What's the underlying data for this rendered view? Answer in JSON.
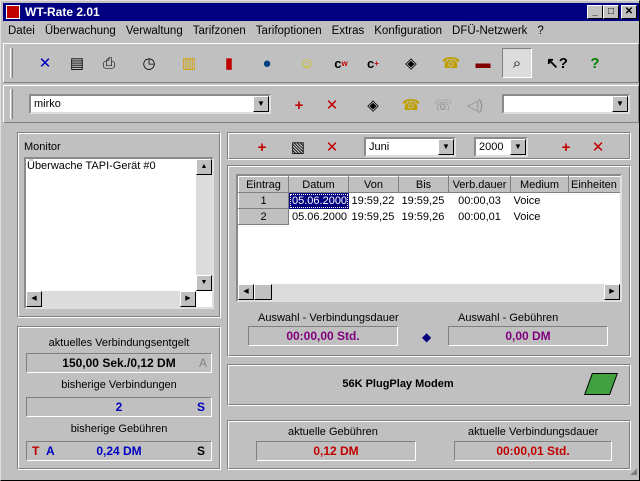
{
  "window": {
    "title": "WT-Rate 2.01",
    "min": "_",
    "max": "□",
    "close": "✕"
  },
  "menu": [
    "Datei",
    "Überwachung",
    "Verwaltung",
    "Tarifzonen",
    "Tarifoptionen",
    "Extras",
    "Konfiguration",
    "DFÜ-Netzwerk",
    "?"
  ],
  "user_combo": {
    "value": "mirko"
  },
  "monitor": {
    "title": "Monitor",
    "lines": [
      "Überwache TAPI-Gerät #0"
    ]
  },
  "left": {
    "label_entgelt": "aktuelles Verbindungsentgelt",
    "value_entgelt": "150,00 Sek./0,12 DM",
    "flag_entgelt": "A",
    "label_verb": "bisherige Verbindungen",
    "value_verb": "2",
    "flag_verb": "S",
    "label_geb": "bisherige Gebühren",
    "value_geb": "0,24 DM",
    "flag_t": "T",
    "flag_a": "A",
    "flag_s": "S"
  },
  "filter": {
    "month": "Juni",
    "year": "2000"
  },
  "table": {
    "headers": [
      "Eintrag",
      "Datum",
      "Von",
      "Bis",
      "Verb.dauer",
      "Medium",
      "Einheiten"
    ],
    "rows": [
      [
        "1",
        "05.06.2000",
        "19:59,22",
        "19:59,25",
        "00:00,03",
        "Voice"
      ],
      [
        "2",
        "05.06.2000",
        "19:59,25",
        "19:59,26",
        "00:00,01",
        "Voice"
      ]
    ]
  },
  "selection": {
    "label_dauer": "Auswahl - Verbindungsdauer",
    "value_dauer": "00:00,00 Std.",
    "label_geb": "Auswahl - Gebühren",
    "value_geb": "0,00 DM"
  },
  "device": {
    "name": "56K PlugPlay Modem"
  },
  "bottom": {
    "label_geb": "aktuelle Gebühren",
    "value_geb": "0,12 DM",
    "label_dauer": "aktuelle Verbindungsdauer",
    "value_dauer": "00:00,01 Std."
  }
}
